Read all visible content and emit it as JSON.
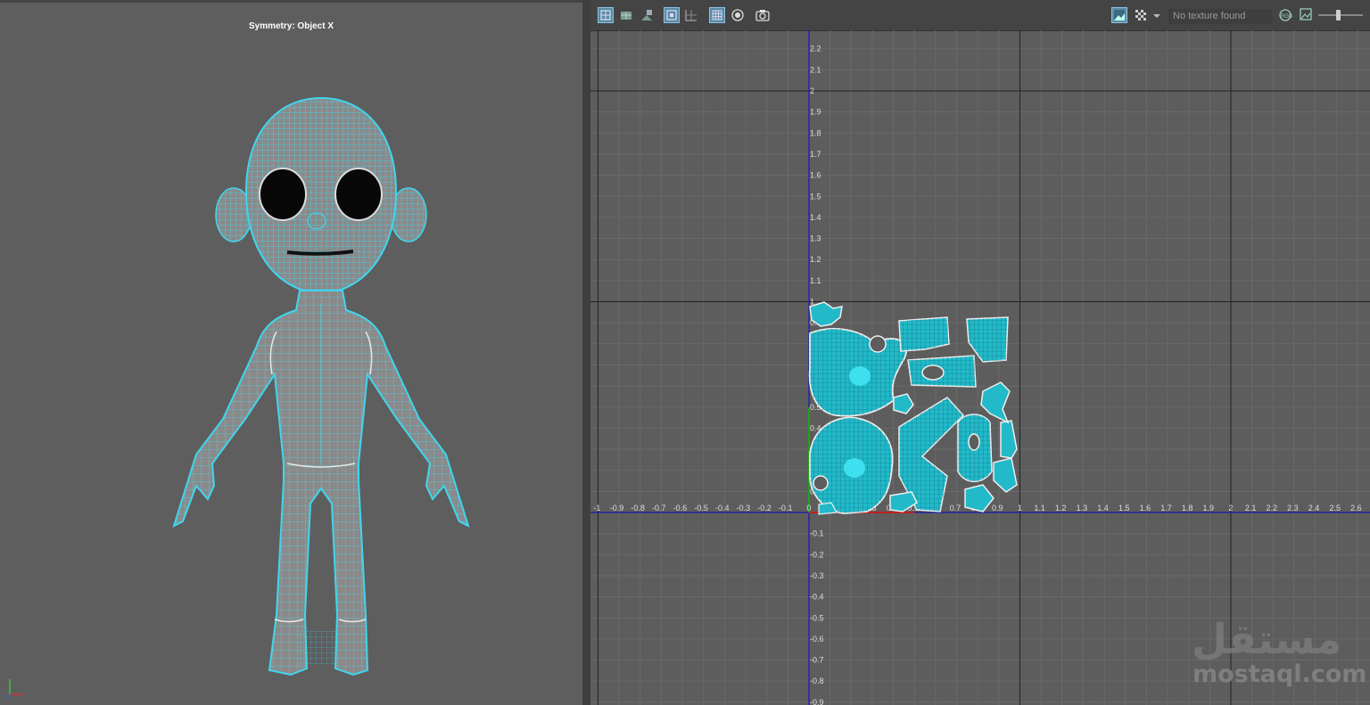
{
  "left_viewport": {
    "symmetry_label": "Symmetry: Object X"
  },
  "uv_editor": {
    "toolbar": {
      "texture_status": "No texture found"
    },
    "axis": {
      "x_ticks": [
        "-1",
        "-0.9",
        "-0.8",
        "-0.7",
        "-0.6",
        "-0.5",
        "-0.4",
        "-0.3",
        "-0.2",
        "-0.1",
        "0",
        "0.1",
        "0.2",
        "0.3",
        "0.4",
        "0.5",
        "0.6",
        "0.7",
        "0.8",
        "0.9",
        "1",
        "1.1",
        "1.2",
        "1.3",
        "1.4",
        "1.5",
        "1.6",
        "1.7",
        "1.8",
        "1.9",
        "2",
        "2.1",
        "2.2",
        "2.3",
        "2.4",
        "2.5",
        "2.6"
      ],
      "y_ticks_pos": [
        "2.2",
        "2.1",
        "2",
        "1.9",
        "1.8",
        "1.7",
        "1.6",
        "1.5",
        "1.4",
        "1.3",
        "1.2",
        "1.1",
        "1",
        "0.9",
        "0.8",
        "0.7",
        "0.6",
        "0.5",
        "0.4",
        "0.3",
        "0.2",
        "0.1"
      ],
      "y_ticks_neg": [
        "-0.1",
        "-0.2",
        "-0.3",
        "-0.4",
        "-0.5",
        "-0.6",
        "-0.7",
        "-0.8",
        "-0.9"
      ]
    }
  },
  "watermark": {
    "arabic": "مستقل",
    "latin": "mostaql.com"
  },
  "colors": {
    "wire": "#3fd6ee",
    "mesh_fill": "#8a8a8a",
    "uv_fill": "#1fb8c8",
    "uv_outline": "#e8e8e8",
    "axis_blue": "#1a1ab0"
  }
}
